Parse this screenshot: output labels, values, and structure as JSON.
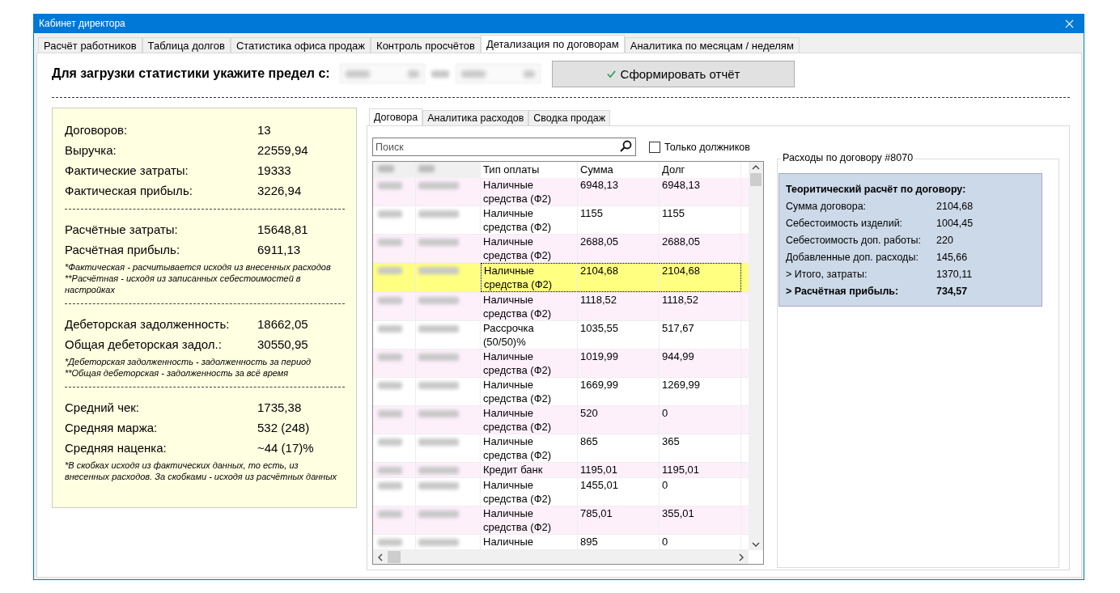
{
  "window": {
    "title": "Кабинет директора"
  },
  "tabs": [
    {
      "label": "Расчёт работников",
      "selected": false
    },
    {
      "label": "Таблица долгов",
      "selected": false
    },
    {
      "label": "Статистика офиса продаж",
      "selected": false
    },
    {
      "label": "Контроль просчётов",
      "selected": false
    },
    {
      "label": "Детализация по договорам",
      "selected": true
    },
    {
      "label": "Аналитика по месяцам / неделям",
      "selected": false
    }
  ],
  "period": {
    "label": "Для загрузки статистики укажите предел с:",
    "report_button": "Сформировать отчёт"
  },
  "summary": {
    "sections": [
      {
        "rows": [
          {
            "label": "Договоров:",
            "value": "13"
          },
          {
            "label": "Выручка:",
            "value": "22559,94"
          },
          {
            "label": "Фактические затраты:",
            "value": "19333"
          },
          {
            "label": "Фактическая прибыль:",
            "value": "3226,94"
          }
        ]
      },
      {
        "rows": [
          {
            "label": "Расчётные затраты:",
            "value": "15648,81"
          },
          {
            "label": "Расчётная прибыль:",
            "value": "6911,13"
          }
        ],
        "notes": [
          "*Фактическая - расчитывается исходя из внесенных расходов",
          "**Расчётная - исходя из записанных себестоимостей в настройках"
        ]
      },
      {
        "rows": [
          {
            "label": "Дебеторская задолженность:",
            "value": "18662,05"
          },
          {
            "label": "Общая дебеторская задол.:",
            "value": "30550,95"
          }
        ],
        "notes": [
          "*Дебеторская задолженность - задолженность за период",
          "**Общая дебеторская - задолженность за всё время"
        ]
      },
      {
        "rows": [
          {
            "label": "Средний чек:",
            "value": "1735,38"
          },
          {
            "label": "Средняя маржа:",
            "value": "532 (248)"
          },
          {
            "label": "Средняя наценка:",
            "value": "~44 (17)%"
          }
        ],
        "notes": [
          "*В скобках исходя из фактических данных, то есть, из внесенных расходов. За скобками - исходя из расчётных данных"
        ]
      }
    ]
  },
  "inner_tabs": [
    {
      "label": "Договора",
      "selected": true
    },
    {
      "label": "Аналитика расходов",
      "selected": false
    },
    {
      "label": "Сводка продаж",
      "selected": false
    }
  ],
  "search": {
    "placeholder": "Поиск"
  },
  "debtors_only": {
    "label": "Только должников",
    "checked": false
  },
  "table": {
    "columns": [
      "Тип оплаты",
      "Сумма",
      "Долг"
    ],
    "rows": [
      {
        "payment_type": "Наличные средства (Ф2)",
        "sum": "6948,13",
        "debt": "6948,13",
        "selected": false
      },
      {
        "payment_type": "Наличные средства (Ф2)",
        "sum": "1155",
        "debt": "1155",
        "selected": false
      },
      {
        "payment_type": "Наличные средства (Ф2)",
        "sum": "2688,05",
        "debt": "2688,05",
        "selected": false
      },
      {
        "payment_type": "Наличные средства (Ф2)",
        "sum": "2104,68",
        "debt": "2104,68",
        "selected": true
      },
      {
        "payment_type": "Наличные средства (Ф2)",
        "sum": "1118,52",
        "debt": "1118,52",
        "selected": false
      },
      {
        "payment_type": "Рассрочка (50/50)%",
        "sum": "1035,55",
        "debt": "517,67",
        "selected": false
      },
      {
        "payment_type": "Наличные средства (Ф2)",
        "sum": "1019,99",
        "debt": "944,99",
        "selected": false
      },
      {
        "payment_type": "Наличные средства (Ф2)",
        "sum": "1669,99",
        "debt": "1269,99",
        "selected": false
      },
      {
        "payment_type": "Наличные средства (Ф2)",
        "sum": "520",
        "debt": "0",
        "selected": false
      },
      {
        "payment_type": "Наличные средства (Ф2)",
        "sum": "865",
        "debt": "365",
        "selected": false
      },
      {
        "payment_type": "Кредит банк",
        "sum": "1195,01",
        "debt": "1195,01",
        "selected": false
      },
      {
        "payment_type": "Наличные средства (Ф2)",
        "sum": "1455,01",
        "debt": "0",
        "selected": false
      },
      {
        "payment_type": "Наличные средства (Ф2)",
        "sum": "785,01",
        "debt": "355,01",
        "selected": false
      },
      {
        "payment_type": "Наличные",
        "sum": "895",
        "debt": "0",
        "selected": false
      }
    ]
  },
  "expenses": {
    "title": "Расходы по договору #8070",
    "heading": "Теоритический расчёт по договору:",
    "rows": [
      {
        "label": "Сумма договора:",
        "value": "2104,68",
        "bold": false
      },
      {
        "label": "Себестоимость изделий:",
        "value": "1004,45",
        "bold": false
      },
      {
        "label": "Себестоимость доп. работы:",
        "value": "220",
        "bold": false
      },
      {
        "label": "Добавленные доп. расходы:",
        "value": "145,66",
        "bold": false
      },
      {
        "label": "> Итого, затраты:",
        "value": "1370,11",
        "bold": false
      },
      {
        "label": "> Расчётная прибыль:",
        "value": "734,57",
        "bold": true
      }
    ]
  }
}
